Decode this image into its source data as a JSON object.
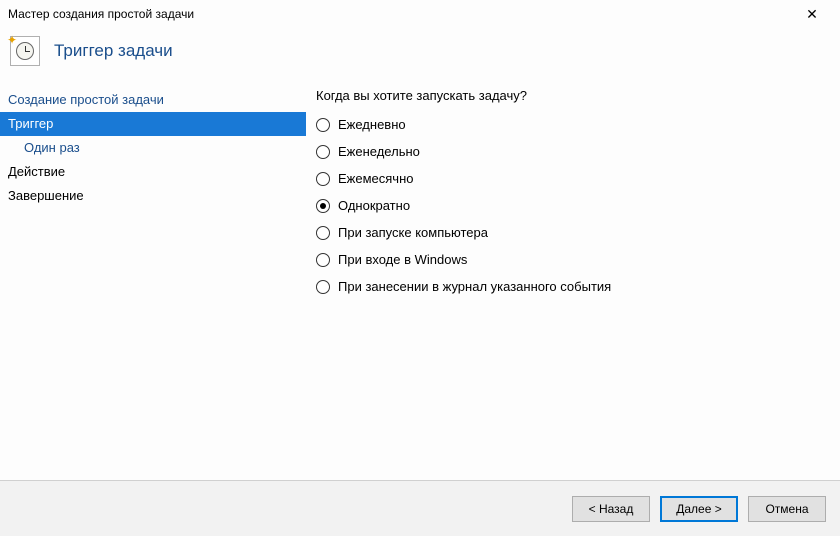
{
  "window": {
    "title": "Мастер создания простой задачи",
    "close_glyph": "✕"
  },
  "header": {
    "title": "Триггер задачи"
  },
  "sidebar": {
    "items": [
      {
        "label": "Создание простой задачи",
        "selected": false,
        "sub": false,
        "link": true
      },
      {
        "label": "Триггер",
        "selected": true,
        "sub": false,
        "link": true
      },
      {
        "label": "Один раз",
        "selected": false,
        "sub": true,
        "link": true
      },
      {
        "label": "Действие",
        "selected": false,
        "sub": false,
        "link": false
      },
      {
        "label": "Завершение",
        "selected": false,
        "sub": false,
        "link": false
      }
    ]
  },
  "main": {
    "question": "Когда вы хотите запускать задачу?",
    "options": [
      {
        "label": "Ежедневно",
        "checked": false
      },
      {
        "label": "Еженедельно",
        "checked": false
      },
      {
        "label": "Ежемесячно",
        "checked": false
      },
      {
        "label": "Однократно",
        "checked": true
      },
      {
        "label": "При запуске компьютера",
        "checked": false
      },
      {
        "label": "При входе в Windows",
        "checked": false
      },
      {
        "label": "При занесении в журнал указанного события",
        "checked": false
      }
    ]
  },
  "footer": {
    "back": "< Назад",
    "next": "Далее >",
    "cancel": "Отмена"
  }
}
